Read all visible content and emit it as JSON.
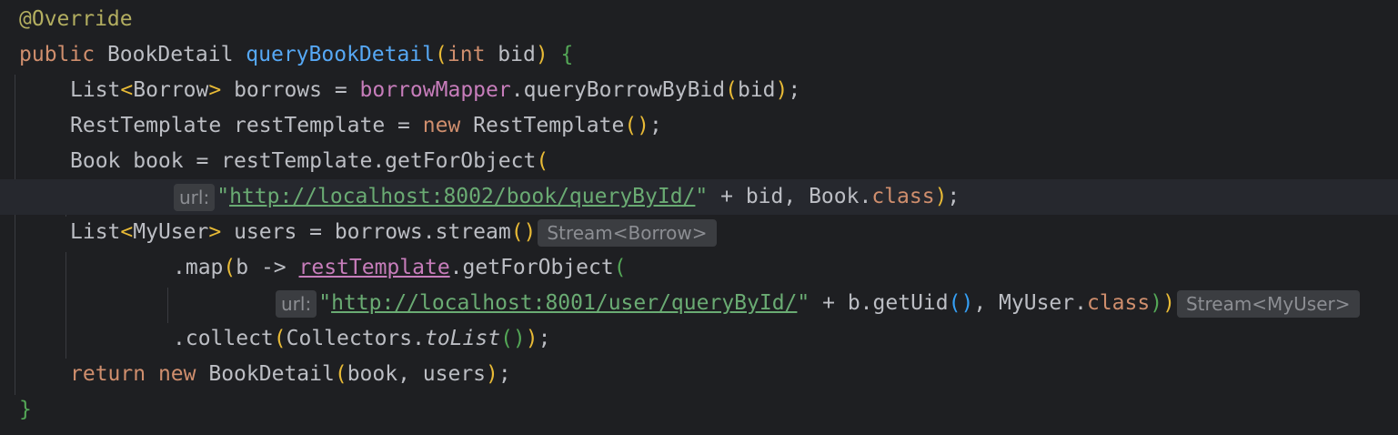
{
  "code": {
    "annotation": "@Override",
    "kw_public": "public",
    "ret_type": "BookDetail",
    "method_name": "queryBookDetail",
    "kw_int": "int",
    "param_bid": "bid",
    "l3": {
      "list": "List",
      "type": "Borrow",
      "decl": "borrows =",
      "mapper": "borrowMapper",
      "call": ".queryBorrowByBid",
      "arg": "bid"
    },
    "l4": {
      "decl": "RestTemplate restTemplate =",
      "kw_new": "new",
      "ctor": "RestTemplate"
    },
    "l5": {
      "decl": "Book book = restTemplate.getForObject"
    },
    "l6": {
      "hint": "url:",
      "url": "http://localhost:8002/book/queryById/",
      "rest": "+ bid, Book.",
      "kw_class": "class"
    },
    "l7": {
      "list": "List",
      "type": "MyUser",
      "decl": "users = borrows.stream",
      "hint": "Stream<Borrow>"
    },
    "l8": {
      "map": ".map",
      "lambda": "b ->",
      "field": "restTemplate",
      "call": ".getForObject"
    },
    "l9": {
      "hint": "url:",
      "url": "http://localhost:8001/user/queryById/",
      "rest": "+ b.getUid",
      "rest2": "MyUser.",
      "kw_class": "class",
      "type_hint": "Stream<MyUser>"
    },
    "l10": {
      "collect": ".collect",
      "collectors": "Collectors.",
      "to_list": "toList"
    },
    "l11": {
      "kw_return": "return",
      "kw_new": "new",
      "ctor": "BookDetail",
      "args": "book, users"
    },
    "closing_brace": "}"
  }
}
